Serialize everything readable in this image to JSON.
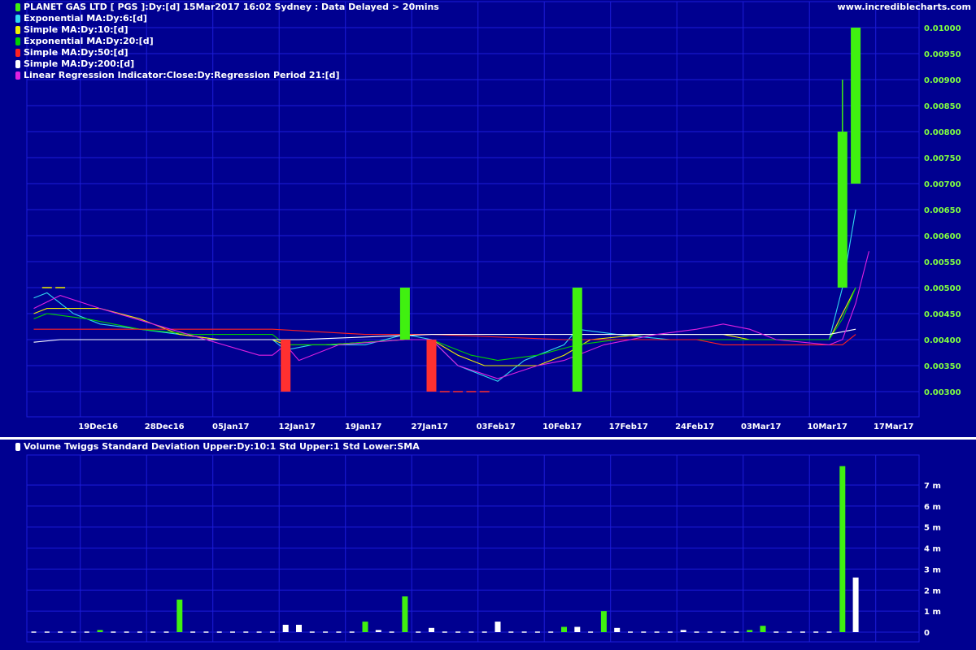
{
  "header": {
    "title": "PLANET GAS LTD [ PGS ]:Dy:[d]  15Mar2017 16:02 Sydney : Data Delayed > 20mins",
    "site": "www.incrediblecharts.com"
  },
  "legend": [
    {
      "label": "Exponential MA:Dy:6:[d]",
      "color": "#30d8f0"
    },
    {
      "label": "Simple MA:Dy:10:[d]",
      "color": "#f0f000"
    },
    {
      "label": "Exponential MA:Dy:20:[d]",
      "color": "#00d000"
    },
    {
      "label": "Simple MA:Dy:50:[d]",
      "color": "#ff2020"
    },
    {
      "label": "Simple MA:Dy:200:[d]",
      "color": "#ffffff"
    },
    {
      "label": "Linear Regression Indicator:Close:Dy:Regression Period 21:[d]",
      "color": "#e020e0"
    }
  ],
  "volume_legend": "Volume Twiggs Standard Deviation Upper:Dy:10:1 Std Upper:1 Std Lower:SMA",
  "colors": {
    "background": "#000090",
    "grid": "#1c1cd8",
    "up": "#40f010",
    "down": "#ff3030",
    "price_label": "#80ff40"
  },
  "chart_data": [
    {
      "type": "candlestick",
      "x_tick_labels": [
        "19Dec16",
        "28Dec16",
        "05Jan17",
        "12Jan17",
        "19Jan17",
        "27Jan17",
        "03Feb17",
        "10Feb17",
        "17Feb17",
        "24Feb17",
        "03Mar17",
        "10Mar17",
        "17Mar17"
      ],
      "y_tick_labels": [
        "0.00300",
        "0.00350",
        "0.00400",
        "0.00450",
        "0.00500",
        "0.00550",
        "0.00600",
        "0.00650",
        "0.00700",
        "0.00750",
        "0.00800",
        "0.00850",
        "0.00900",
        "0.00950",
        "0.01000"
      ],
      "ylim": [
        0.0027,
        0.0104
      ],
      "candles": [
        {
          "i": 19,
          "open": 0.004,
          "close": 0.003,
          "high": 0.004,
          "low": 0.003
        },
        {
          "i": 28,
          "open": 0.004,
          "close": 0.005,
          "high": 0.005,
          "low": 0.004
        },
        {
          "i": 30,
          "open": 0.004,
          "close": 0.003,
          "high": 0.004,
          "low": 0.003
        },
        {
          "i": 41,
          "open": 0.003,
          "close": 0.005,
          "high": 0.005,
          "low": 0.003
        },
        {
          "i": 61,
          "open": 0.005,
          "close": 0.008,
          "high": 0.009,
          "low": 0.005
        },
        {
          "i": 62,
          "open": 0.007,
          "close": 0.01,
          "high": 0.01,
          "low": 0.007
        }
      ],
      "flat_closes": [
        {
          "i": 1,
          "value": 0.005
        },
        {
          "i": 2,
          "value": 0.005
        },
        {
          "i": 31,
          "value": 0.003
        },
        {
          "i": 32,
          "value": 0.003
        },
        {
          "i": 33,
          "value": 0.003
        },
        {
          "i": 34,
          "value": 0.003
        }
      ],
      "series": [
        {
          "name": "Exponential MA:Dy:6:[d]",
          "color": "#30d8f0",
          "points": [
            [
              0,
              0.0048
            ],
            [
              1,
              0.0049
            ],
            [
              3,
              0.0045
            ],
            [
              5,
              0.0043
            ],
            [
              8,
              0.0042
            ],
            [
              11,
              0.0041
            ],
            [
              14,
              0.004
            ],
            [
              18,
              0.004
            ],
            [
              19,
              0.0038
            ],
            [
              21,
              0.0039
            ],
            [
              25,
              0.0039
            ],
            [
              28,
              0.0041
            ],
            [
              30,
              0.004
            ],
            [
              32,
              0.0035
            ],
            [
              35,
              0.0032
            ],
            [
              37,
              0.0036
            ],
            [
              40,
              0.0039
            ],
            [
              41,
              0.0042
            ],
            [
              44,
              0.0041
            ],
            [
              48,
              0.004
            ],
            [
              55,
              0.004
            ],
            [
              60,
              0.004
            ],
            [
              61,
              0.005
            ],
            [
              62,
              0.0065
            ]
          ]
        },
        {
          "name": "Simple MA:Dy:10:[d]",
          "color": "#f0f000",
          "points": [
            [
              0,
              0.0045
            ],
            [
              1,
              0.0046
            ],
            [
              2,
              0.0046
            ],
            [
              5,
              0.0046
            ],
            [
              8,
              0.0044
            ],
            [
              11,
              0.0041
            ],
            [
              14,
              0.004
            ],
            [
              18,
              0.004
            ],
            [
              19,
              0.0039
            ],
            [
              22,
              0.0039
            ],
            [
              28,
              0.004
            ],
            [
              30,
              0.004
            ],
            [
              32,
              0.0037
            ],
            [
              34,
              0.0035
            ],
            [
              38,
              0.0035
            ],
            [
              40,
              0.0037
            ],
            [
              42,
              0.004
            ],
            [
              46,
              0.0041
            ],
            [
              49,
              0.0041
            ],
            [
              52,
              0.0041
            ],
            [
              54,
              0.004
            ],
            [
              60,
              0.004
            ],
            [
              61,
              0.0045
            ],
            [
              62,
              0.005
            ]
          ]
        },
        {
          "name": "Exponential MA:Dy:20:[d]",
          "color": "#00d000",
          "points": [
            [
              0,
              0.0044
            ],
            [
              1,
              0.0045
            ],
            [
              4,
              0.0044
            ],
            [
              8,
              0.0042
            ],
            [
              12,
              0.0041
            ],
            [
              18,
              0.0041
            ],
            [
              19,
              0.0039
            ],
            [
              22,
              0.0039
            ],
            [
              28,
              0.004
            ],
            [
              30,
              0.004
            ],
            [
              33,
              0.0037
            ],
            [
              35,
              0.0036
            ],
            [
              38,
              0.0037
            ],
            [
              41,
              0.0039
            ],
            [
              44,
              0.004
            ],
            [
              50,
              0.004
            ],
            [
              55,
              0.004
            ],
            [
              60,
              0.004
            ],
            [
              61,
              0.0044
            ],
            [
              62,
              0.005
            ]
          ]
        },
        {
          "name": "Simple MA:Dy:50:[d]",
          "color": "#ff2020",
          "points": [
            [
              0,
              0.0042
            ],
            [
              3,
              0.0042
            ],
            [
              10,
              0.0042
            ],
            [
              18,
              0.0042
            ],
            [
              25,
              0.0041
            ],
            [
              30,
              0.0041
            ],
            [
              40,
              0.004
            ],
            [
              50,
              0.004
            ],
            [
              52,
              0.0039
            ],
            [
              60,
              0.0039
            ],
            [
              61,
              0.0039
            ],
            [
              62,
              0.0041
            ]
          ]
        },
        {
          "name": "Simple MA:Dy:200:[d]",
          "color": "#ffffff",
          "points": [
            [
              0,
              0.00395
            ],
            [
              2,
              0.004
            ],
            [
              10,
              0.004
            ],
            [
              20,
              0.004
            ],
            [
              30,
              0.0041
            ],
            [
              40,
              0.0041
            ],
            [
              50,
              0.0041
            ],
            [
              60,
              0.0041
            ],
            [
              62,
              0.0042
            ]
          ]
        },
        {
          "name": "Linear Regression Indicator:Close:Dy:Regression Period 21:[d]",
          "color": "#e020e0",
          "points": [
            [
              0,
              0.0046
            ],
            [
              2,
              0.00485
            ],
            [
              5,
              0.0046
            ],
            [
              9,
              0.0043
            ],
            [
              13,
              0.004
            ],
            [
              17,
              0.0037
            ],
            [
              18,
              0.0037
            ],
            [
              19,
              0.0039
            ],
            [
              20,
              0.0036
            ],
            [
              23,
              0.0039
            ],
            [
              28,
              0.004
            ],
            [
              30,
              0.004
            ],
            [
              32,
              0.0035
            ],
            [
              35,
              0.00325
            ],
            [
              38,
              0.0035
            ],
            [
              40,
              0.0036
            ],
            [
              43,
              0.0039
            ],
            [
              47,
              0.0041
            ],
            [
              50,
              0.0042
            ],
            [
              52,
              0.0043
            ],
            [
              54,
              0.0042
            ],
            [
              56,
              0.004
            ],
            [
              60,
              0.0039
            ],
            [
              61,
              0.004
            ],
            [
              62,
              0.0047
            ],
            [
              63,
              0.0057
            ]
          ]
        }
      ]
    },
    {
      "type": "bar",
      "y_tick_labels": [
        "0",
        "1 m",
        "2 m",
        "3 m",
        "4 m",
        "5 m",
        "6 m",
        "7 m"
      ],
      "ylim": [
        0,
        8
      ],
      "bars": [
        {
          "i": 5,
          "value": 0.1,
          "color": "#40f010"
        },
        {
          "i": 11,
          "value": 1.55,
          "color": "#40f010"
        },
        {
          "i": 19,
          "value": 0.35,
          "color": "#ffffff"
        },
        {
          "i": 20,
          "value": 0.35,
          "color": "#ffffff"
        },
        {
          "i": 25,
          "value": 0.5,
          "color": "#40f010"
        },
        {
          "i": 26,
          "value": 0.1,
          "color": "#ffffff"
        },
        {
          "i": 28,
          "value": 1.7,
          "color": "#40f010"
        },
        {
          "i": 30,
          "value": 0.2,
          "color": "#ffffff"
        },
        {
          "i": 35,
          "value": 0.5,
          "color": "#ffffff"
        },
        {
          "i": 40,
          "value": 0.25,
          "color": "#40f010"
        },
        {
          "i": 41,
          "value": 0.25,
          "color": "#ffffff"
        },
        {
          "i": 43,
          "value": 1.0,
          "color": "#40f010"
        },
        {
          "i": 44,
          "value": 0.2,
          "color": "#ffffff"
        },
        {
          "i": 49,
          "value": 0.1,
          "color": "#ffffff"
        },
        {
          "i": 54,
          "value": 0.1,
          "color": "#40f010"
        },
        {
          "i": 55,
          "value": 0.3,
          "color": "#40f010"
        },
        {
          "i": 61,
          "value": 7.9,
          "color": "#40f010"
        },
        {
          "i": 62,
          "value": 2.6,
          "color": "#ffffff"
        }
      ]
    }
  ]
}
